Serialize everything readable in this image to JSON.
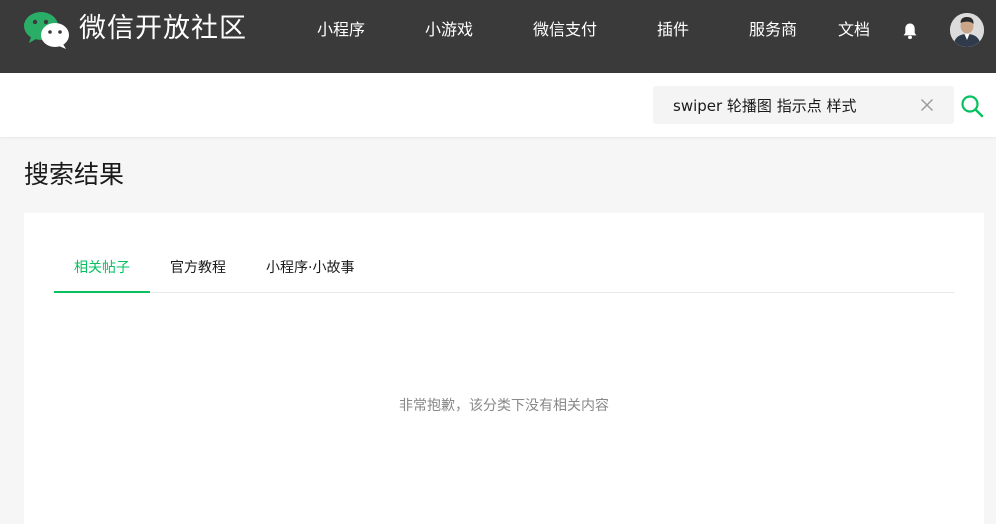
{
  "header": {
    "site_title": "微信开放社区",
    "logo_icon": "wechat-logo-icon",
    "nav": [
      {
        "label": "小程序"
      },
      {
        "label": "小游戏"
      },
      {
        "label": "微信支付"
      },
      {
        "label": "插件"
      },
      {
        "label": "服务商"
      },
      {
        "label": "文档"
      }
    ],
    "notification_icon": "bell-icon",
    "avatar_icon": "user-avatar"
  },
  "search": {
    "value": "swiper 轮播图 指示点 样式",
    "clear_icon": "close-icon",
    "search_icon": "search-icon"
  },
  "page": {
    "title": "搜索结果"
  },
  "results": {
    "tabs": [
      {
        "label": "相关帖子",
        "active": true
      },
      {
        "label": "官方教程",
        "active": false
      },
      {
        "label": "小程序·小故事",
        "active": false
      }
    ],
    "empty_message": "非常抱歉，该分类下没有相关内容"
  },
  "colors": {
    "header_bg": "#3a3a3a",
    "accent": "#07c160",
    "page_bg": "#f6f6f6"
  }
}
